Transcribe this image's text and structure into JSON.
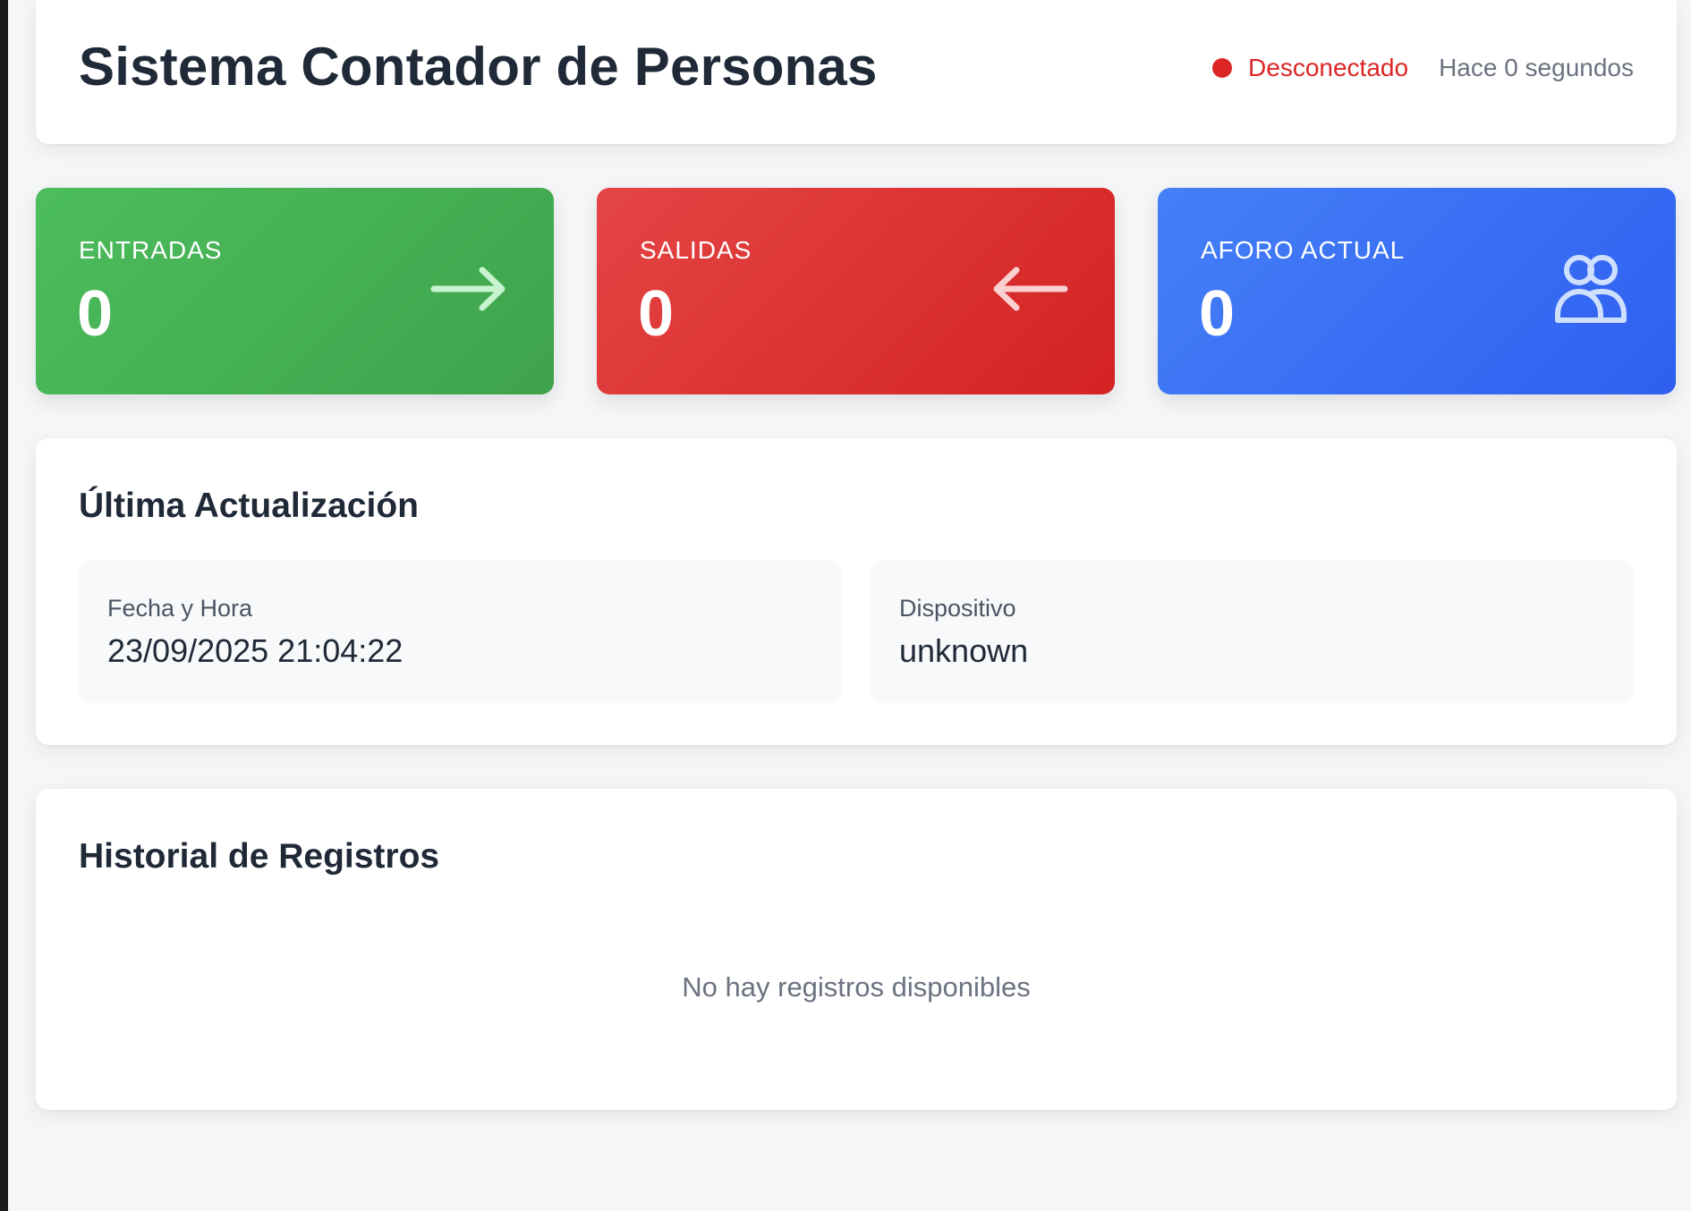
{
  "header": {
    "title": "Sistema Contador de Personas",
    "status_label": "Desconectado",
    "last_seen": "Hace 0 segundos"
  },
  "stats": [
    {
      "label": "ENTRADAS",
      "value": "0",
      "icon": "arrow-right-icon",
      "color": "#45af52"
    },
    {
      "label": "SALIDAS",
      "value": "0",
      "icon": "arrow-left-icon",
      "color": "#dc3333"
    },
    {
      "label": "AFORO ACTUAL",
      "value": "0",
      "icon": "users-icon",
      "color": "#3a6ff4"
    }
  ],
  "last_update": {
    "title": "Última Actualización",
    "datetime_label": "Fecha y Hora",
    "datetime_value": "23/09/2025 21:04:22",
    "device_label": "Dispositivo",
    "device_value": "unknown"
  },
  "history": {
    "title": "Historial de Registros",
    "empty_message": "No hay registros disponibles"
  },
  "colors": {
    "status_disconnected": "#dc2626",
    "page_background": "#f5f6f8"
  }
}
